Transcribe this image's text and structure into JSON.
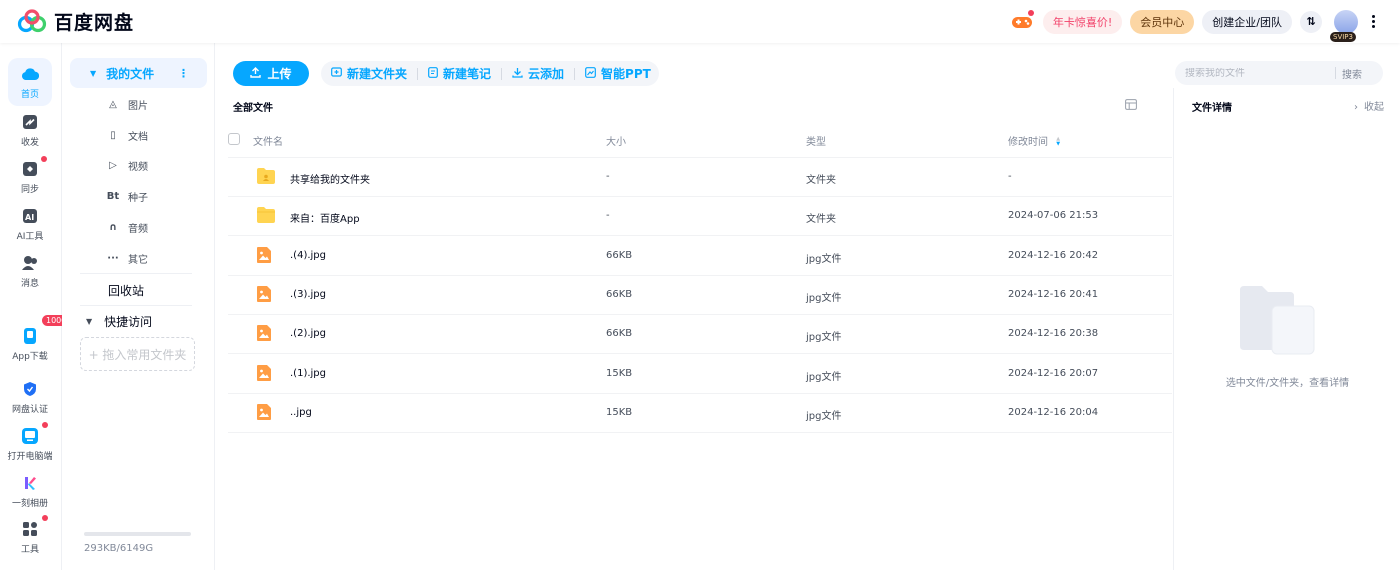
{
  "app": {
    "name": "百度网盘",
    "brand_color": "#06a7ff"
  },
  "header": {
    "year_card": "年卡惊喜价!",
    "vip_center": "会员中心",
    "create_team": "创建企业/团队",
    "transfer": "⇅",
    "svip_badge": "SVIP3"
  },
  "rail": {
    "items": [
      {
        "label": "首页",
        "icon": "cloud-icon",
        "active": true
      },
      {
        "label": "收发",
        "icon": "share-icon"
      },
      {
        "label": "同步",
        "icon": "sync-icon"
      },
      {
        "label": "AI工具",
        "icon": "ai-icon"
      },
      {
        "label": "消息",
        "icon": "message-icon"
      },
      {
        "label": "App下载",
        "icon": "phone-icon",
        "badge": "100G"
      },
      {
        "label": "网盘认证",
        "icon": "verify-icon"
      },
      {
        "label": "打开电脑端",
        "icon": "desktop-icon"
      },
      {
        "label": "一刻相册",
        "icon": "album-icon"
      },
      {
        "label": "工具",
        "icon": "tools-icon"
      }
    ]
  },
  "sidenav": {
    "my_files": "我的文件",
    "more": "⋮",
    "categories": [
      {
        "label": "图片",
        "icon": "image-icon",
        "glyph": "◬"
      },
      {
        "label": "文档",
        "icon": "document-icon",
        "glyph": "▯"
      },
      {
        "label": "视频",
        "icon": "video-icon",
        "glyph": "▷"
      },
      {
        "label": "种子",
        "icon": "torrent-icon",
        "glyph": "Bt"
      },
      {
        "label": "音频",
        "icon": "audio-icon",
        "glyph": "∩"
      },
      {
        "label": "其它",
        "icon": "other-icon",
        "glyph": "···"
      }
    ],
    "recycle": "回收站",
    "quick_access": "快捷访问",
    "drop_hint": "+ 拖入常用文件夹",
    "quota_text": "293KB/6149G",
    "quota_used": 0.0
  },
  "toolbar": {
    "upload": "上传",
    "new_folder": "新建文件夹",
    "new_note": "新建笔记",
    "cloud_add": "云添加",
    "smart_ppt": "智能PPT"
  },
  "breadcrumb": "全部文件",
  "table": {
    "columns": {
      "name": "文件名",
      "size": "大小",
      "type": "类型",
      "modified": "修改时间"
    },
    "rows": [
      {
        "name": "共享给我的文件夹",
        "size": "-",
        "type": "文件夹",
        "modified": "-",
        "kind": "shared-folder"
      },
      {
        "name": "来自：百度App",
        "size": "-",
        "type": "文件夹",
        "modified": "2024-07-06 21:53",
        "kind": "folder"
      },
      {
        "name": ".(4).jpg",
        "size": "66KB",
        "type": "jpg文件",
        "modified": "2024-12-16 20:42",
        "kind": "image"
      },
      {
        "name": ".(3).jpg",
        "size": "66KB",
        "type": "jpg文件",
        "modified": "2024-12-16 20:41",
        "kind": "image"
      },
      {
        "name": ".(2).jpg",
        "size": "66KB",
        "type": "jpg文件",
        "modified": "2024-12-16 20:38",
        "kind": "image"
      },
      {
        "name": ".(1).jpg",
        "size": "15KB",
        "type": "jpg文件",
        "modified": "2024-12-16 20:07",
        "kind": "image"
      },
      {
        "name": "..jpg",
        "size": "15KB",
        "type": "jpg文件",
        "modified": "2024-12-16 20:04",
        "kind": "image"
      }
    ]
  },
  "search": {
    "placeholder": "搜索我的文件",
    "button": "搜索"
  },
  "detail": {
    "title": "文件详情",
    "collapse": "收起",
    "empty_text": "选中文件/文件夹，查看详情"
  }
}
